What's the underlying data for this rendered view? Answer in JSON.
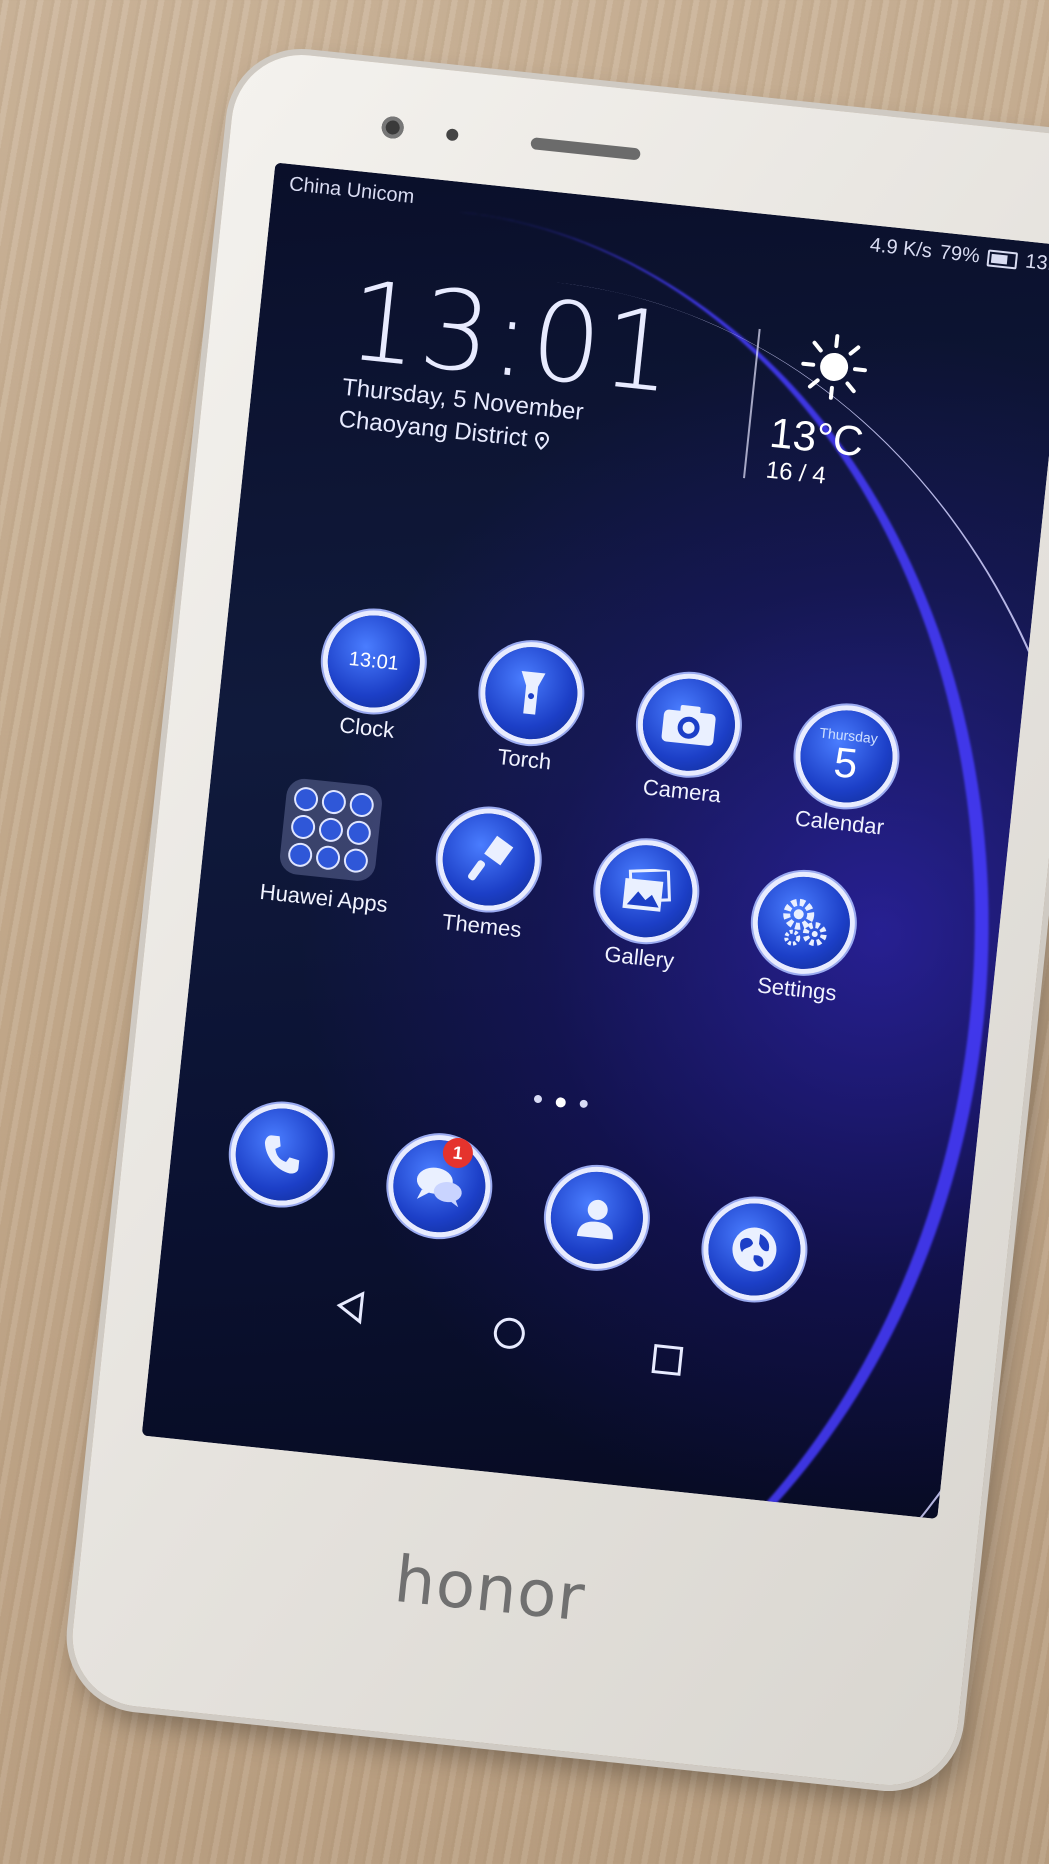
{
  "status_bar": {
    "carrier": "China Unicom",
    "speed": "4.9 K/s",
    "battery": "79%",
    "time": "13:"
  },
  "clock_widget": {
    "time": "13:01",
    "date": "Thursday, 5 November",
    "location": "Chaoyang District"
  },
  "weather": {
    "temperature": "13°C",
    "range": "16 / 4"
  },
  "apps": [
    {
      "label": "Clock",
      "icon": "clock-icon",
      "icon_text": "13:01"
    },
    {
      "label": "Torch",
      "icon": "torch-icon"
    },
    {
      "label": "Camera",
      "icon": "camera-icon"
    },
    {
      "label": "Calendar",
      "icon": "calendar-icon",
      "day": "Thursday",
      "date": "5"
    },
    {
      "label": "Huawei Apps",
      "icon": "folder-icon"
    },
    {
      "label": "Themes",
      "icon": "themes-icon"
    },
    {
      "label": "Gallery",
      "icon": "gallery-icon"
    },
    {
      "label": "Settings",
      "icon": "settings-icon"
    }
  ],
  "dock": [
    {
      "icon": "phone-icon"
    },
    {
      "icon": "messages-icon",
      "badge": "1"
    },
    {
      "icon": "contacts-icon"
    },
    {
      "icon": "browser-icon"
    }
  ],
  "brand": "honor",
  "colors": {
    "accent": "#2f57d8",
    "badge": "#e5332d"
  }
}
